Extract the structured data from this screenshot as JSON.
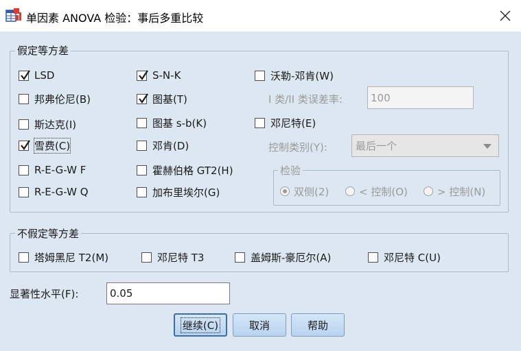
{
  "window": {
    "title": "单因素 ANOVA 检验：事后多重比较",
    "close_icon": "close-icon"
  },
  "equal_variance": {
    "legend": "假定等方差",
    "lsd": {
      "label": "LSD",
      "checked": true
    },
    "bonferroni": {
      "label": "邦弗伦尼(B)",
      "checked": false
    },
    "sidak": {
      "label": "斯达克(I)",
      "checked": false
    },
    "scheffe": {
      "label": "雪费(C)",
      "checked": true
    },
    "regwf": {
      "label": "R-E-G-W F",
      "checked": false
    },
    "regwq": {
      "label": "R-E-G-W Q",
      "checked": false
    },
    "snk": {
      "label": "S-N-K",
      "checked": true
    },
    "tukey": {
      "label": "图基(T)",
      "checked": true
    },
    "tukey_b": {
      "label": "图基 s-b(K)",
      "checked": false
    },
    "duncan": {
      "label": "邓肯(D)",
      "checked": false
    },
    "hochberg": {
      "label": "霍赫伯格 GT2(H)",
      "checked": false
    },
    "gabriel": {
      "label": "加布里埃尔(G)",
      "checked": false
    },
    "waller": {
      "label": "沃勒-邓肯(W)",
      "checked": false
    },
    "error_ratio_label": "I 类/II 类误差率:",
    "error_ratio_value": "100",
    "dunnett": {
      "label": "邓尼特(E)",
      "checked": false
    },
    "control_category_label": "控制类别(Y):",
    "control_category_value": "最后一个",
    "test_group": {
      "legend": "检验",
      "two_sided": {
        "label": "双侧(2)",
        "selected": true
      },
      "less_control": {
        "label": "< 控制(O)",
        "selected": false
      },
      "greater_control": {
        "label": "> 控制(N)",
        "selected": false
      }
    }
  },
  "unequal_variance": {
    "legend": "不假定等方差",
    "tamhane": {
      "label": "塔姆黑尼 T2(M)",
      "checked": false
    },
    "dunnett_t3": {
      "label": "邓尼特 T3",
      "checked": false
    },
    "games_howell": {
      "label": "盖姆斯-豪厄尔(A)",
      "checked": false
    },
    "dunnett_c": {
      "label": "邓尼特 C(U)",
      "checked": false
    }
  },
  "significance": {
    "label": "显著性水平(F):",
    "value": "0.05"
  },
  "buttons": {
    "continue": "继续(C)",
    "cancel": "取消",
    "help": "帮助"
  }
}
